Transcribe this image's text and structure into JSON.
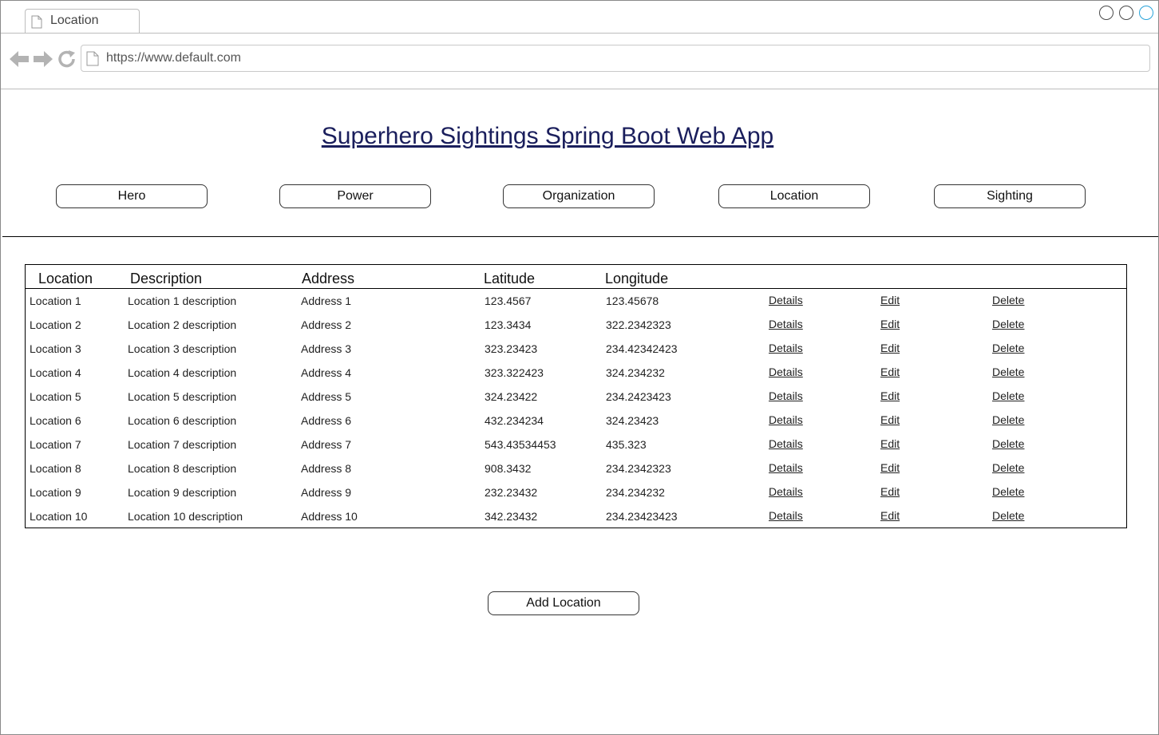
{
  "browser": {
    "tab_title": "Location",
    "url": "https://www.default.com"
  },
  "page": {
    "title": "Superhero Sightings Spring Boot Web App",
    "nav_buttons": [
      "Hero",
      "Power",
      "Organization",
      "Location",
      "Sighting"
    ],
    "table": {
      "headers": [
        "Location",
        "Description",
        "Address",
        "Latitude",
        "Longitude"
      ],
      "action_labels": {
        "details": "Details",
        "edit": "Edit",
        "delete": "Delete"
      },
      "rows": [
        [
          "Location 1",
          "Location 1 description",
          "Address 1",
          "123.4567",
          "123.45678"
        ],
        [
          "Location 2",
          "Location 2 description",
          "Address 2",
          "123.3434",
          "322.2342323"
        ],
        [
          "Location 3",
          "Location 3 description",
          "Address 3",
          "323.23423",
          "234.42342423"
        ],
        [
          "Location 4",
          "Location 4 description",
          "Address 4",
          "323.322423",
          "324.234232"
        ],
        [
          "Location 5",
          "Location 5 description",
          "Address 5",
          "324.23422",
          "234.2423423"
        ],
        [
          "Location 6",
          "Location 6 description",
          "Address 6",
          "432.234234",
          "324.23423"
        ],
        [
          "Location 7",
          "Location 7 description",
          "Address 7",
          "543.43534453",
          "435.323"
        ],
        [
          "Location 8",
          "Location 8 description",
          "Address 8",
          "908.3432",
          "234.2342323"
        ],
        [
          "Location 9",
          "Location 9 description",
          "Address 9",
          "232.23432",
          "234.234232"
        ],
        [
          "Location 10",
          "Location 10 description",
          "Address 10",
          "342.23432",
          "234.23423423"
        ]
      ]
    },
    "add_button": "Add Location"
  },
  "colors": {
    "title": "#1a1e5c",
    "window_button_active": "#29a3d9"
  }
}
